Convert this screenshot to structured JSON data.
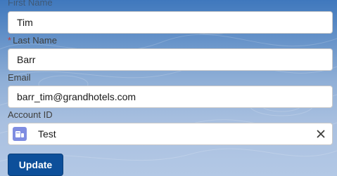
{
  "form": {
    "first_name": {
      "label": "First Name",
      "value": "Tim"
    },
    "last_name": {
      "label": "Last Name",
      "required_marker": "*",
      "value": "Barr"
    },
    "email": {
      "label": "Email",
      "value": "barr_tim@grandhotels.com"
    },
    "account_id": {
      "label": "Account ID",
      "value": "Test",
      "icon": "account-icon",
      "clear_icon": "close-icon"
    },
    "update_label": "Update"
  },
  "colors": {
    "button_bg": "#0d4f9a",
    "required": "#c23934",
    "account_icon": "#7f8de1"
  }
}
